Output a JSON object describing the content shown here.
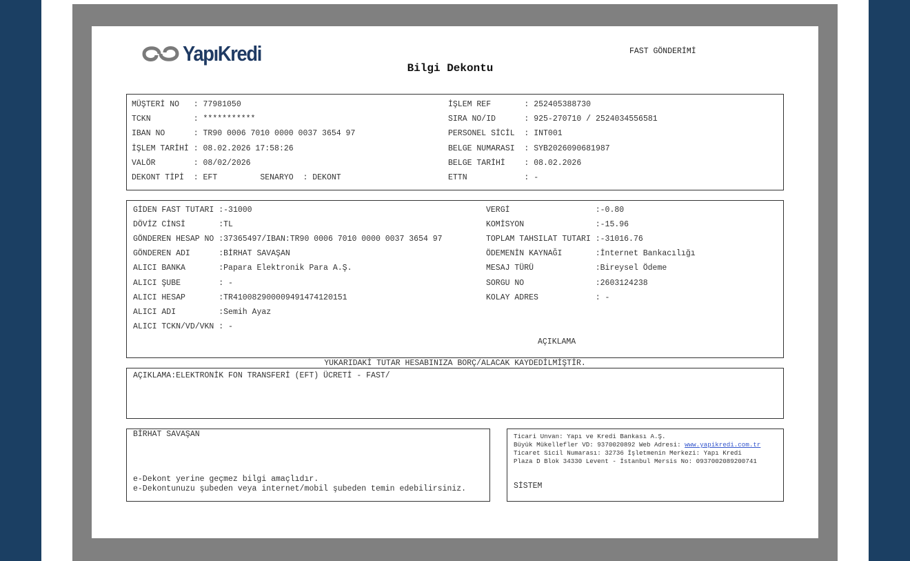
{
  "brand": {
    "logo_text": "YapıKredi",
    "accent": "#1f3a63",
    "logo_gray": "#7a7a7a"
  },
  "header": {
    "transfer_type": "FAST GÖNDERİMİ",
    "title": "Bilgi Dekontu"
  },
  "customer": {
    "left": [
      {
        "label": "MÜŞTERİ NO   ",
        "value": ": 77981050"
      },
      {
        "label": "TCKN         ",
        "value": ": ***********"
      },
      {
        "label": "IBAN NO      ",
        "value": ": TR90 0006 7010 0000 0037 3654 97"
      },
      {
        "label": "İŞLEM TARİHİ ",
        "value": ": 08.02.2026 17:58:26"
      },
      {
        "label": "VALÖR        ",
        "value": ": 08/02/2026"
      },
      {
        "label": "DEKONT TİPİ  ",
        "value": ": EFT         SENARYO  : DEKONT"
      }
    ],
    "right": [
      {
        "label": "İŞLEM REF       ",
        "value": ": 252405388730"
      },
      {
        "label": "SIRA NO/ID      ",
        "value": ": 925-270710 / 2524034556581"
      },
      {
        "label": "PERSONEL SİCİL  ",
        "value": ": INT001"
      },
      {
        "label": "BELGE NUMARASI  ",
        "value": ": SYB2026090681987"
      },
      {
        "label": "BELGE TARİHİ    ",
        "value": ": 08.02.2026"
      },
      {
        "label": "ETTN            ",
        "value": ": -"
      }
    ]
  },
  "transfer": {
    "left": [
      {
        "label": "GİDEN FAST TUTARI ",
        "value": ":-31000"
      },
      {
        "label": "DÖVİZ CİNSİ       ",
        "value": ":TL"
      },
      {
        "label": "GÖNDEREN HESAP NO ",
        "value": ":37365497/IBAN:TR90 0006 7010 0000 0037 3654 97"
      },
      {
        "label": "GÖNDEREN ADI      ",
        "value": ":BİRHAT SAVAŞAN"
      },
      {
        "label": "ALICI BANKA       ",
        "value": ":Papara Elektronik Para A.Ş."
      },
      {
        "label": "ALICI ŞUBE        ",
        "value": ": -"
      },
      {
        "label": "ALICI HESAP       ",
        "value": ":TR410082900009491474120151"
      },
      {
        "label": "ALICI ADI         ",
        "value": ":Semih Ayaz"
      },
      {
        "label": "ALICI TCKN/VD/VKN ",
        "value": ": -"
      }
    ],
    "right": [
      {
        "label": "VERGİ                  ",
        "value": ":-0.80"
      },
      {
        "label": "KOMİSYON               ",
        "value": ":-15.96"
      },
      {
        "label": "TOPLAM TAHSILAT TUTARI ",
        "value": ":-31016.76"
      },
      {
        "label": "ÖDEMENİN KAYNAĞI       ",
        "value": ":İnternet Bankacılığı"
      },
      {
        "label": "MESAJ TÜRÜ             ",
        "value": ":Bireysel Ödeme"
      },
      {
        "label": "SORGU NO               ",
        "value": ":2603124238"
      },
      {
        "label": "KOLAY ADRES            ",
        "value": ": -"
      }
    ],
    "aciklama_heading": "AÇIKLAMA"
  },
  "notice": "YUKARIDAKİ TUTAR HESABINIZA BORÇ/ALACAK KAYDEDİLMİŞTİR.",
  "description": "AÇIKLAMA:ELEKTRONİK FON TRANSFERİ (EFT) ÜCRETİ - FAST/",
  "footer_left": {
    "name": "BİRHAT SAVAŞAN",
    "note1": "e-Dekont yerine geçmez bilgi amaçlıdır.",
    "note2": "e-Dekontunuzu şubeden veya internet/mobil şubeden temin edebilirsiniz."
  },
  "footer_right": {
    "line1": "Ticari Unvan: Yapı ve Kredi Bankası A.Ş.",
    "line2_prefix": "Büyük Mükellefler VD: 9370020892 Web Adresi: ",
    "website": "www.yapikredi.com.tr",
    "line3": "Ticaret Sicil Numarası: 32736 İşletmenin Merkezi: Yapı Kredi",
    "line4": "Plaza D Blok 34330 Levent - İstanbul Mersis No: 0937002089200741",
    "system": "SİSTEM"
  }
}
